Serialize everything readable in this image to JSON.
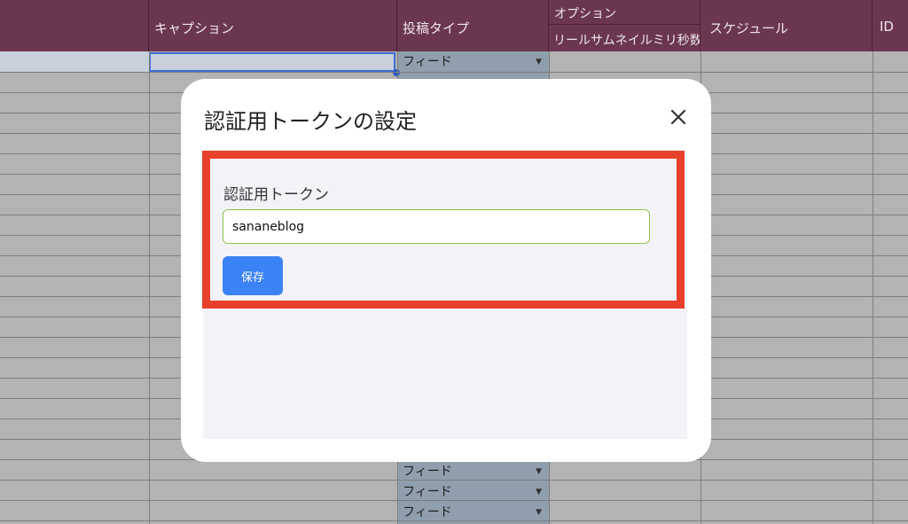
{
  "sheet": {
    "headers": {
      "caption": "キャプション",
      "post_type": "投稿タイプ",
      "options": "オプション",
      "reel_thumb_ms": "リールサムネイルミリ秒数",
      "schedule": "スケジュール",
      "id": "ID"
    },
    "feed_value": "フィード"
  },
  "modal": {
    "title": "認証用トークンの設定",
    "close_icon": "close-icon",
    "field_label": "認証用トークン",
    "token_value": "sananeblog",
    "save_label": "保存"
  },
  "colors": {
    "header_bg": "#6b3750",
    "highlight_border": "#e8412b",
    "save_button": "#3b82f6",
    "input_border": "#8bc34a"
  }
}
